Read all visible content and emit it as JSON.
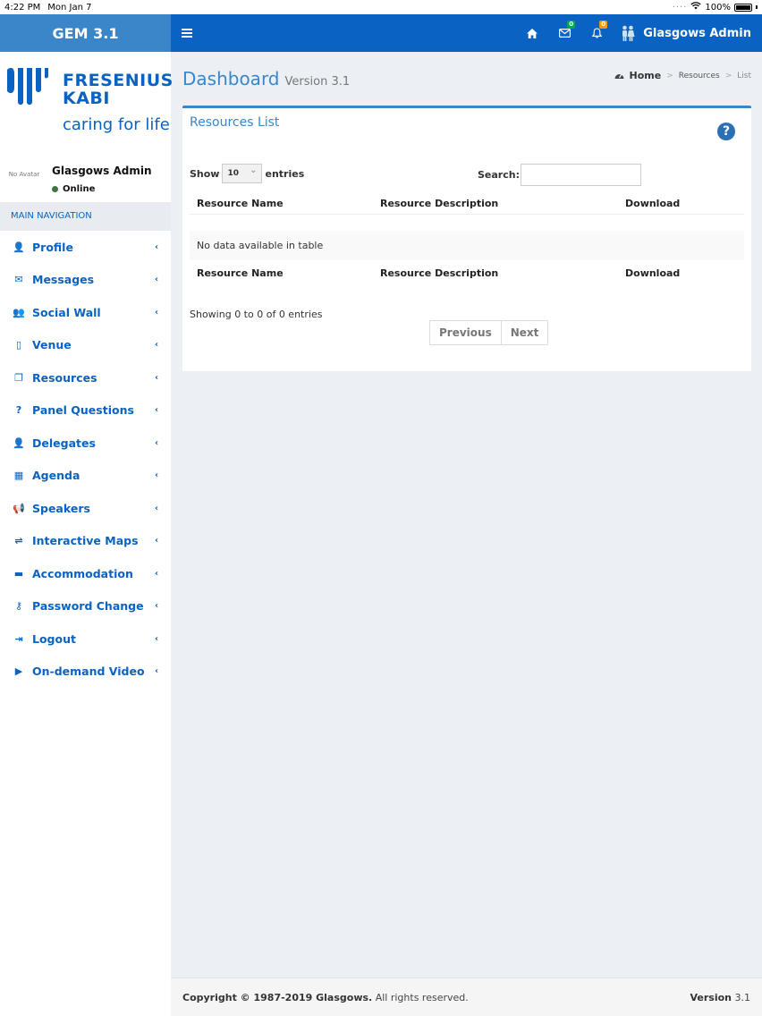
{
  "status_bar": {
    "time": "4:22 PM",
    "date": "Mon Jan 7",
    "battery": "100%"
  },
  "header": {
    "app_name": "GEM 3.1",
    "messages_count": "0",
    "notifications_count": "0",
    "user": "Glasgows Admin"
  },
  "brand": {
    "line1": "FRESENIUS",
    "line2": "KABI",
    "tagline": "caring for life"
  },
  "user_panel": {
    "avatar_text": "No Avatar",
    "name": "Glasgows Admin",
    "status": "Online"
  },
  "sidebar": {
    "header": "MAIN NAVIGATION",
    "items": [
      {
        "label": "Profile",
        "icon": "user-icon"
      },
      {
        "label": "Messages",
        "icon": "envelope-icon"
      },
      {
        "label": "Social Wall",
        "icon": "users-icon"
      },
      {
        "label": "Venue",
        "icon": "building-icon"
      },
      {
        "label": "Resources",
        "icon": "copy-icon"
      },
      {
        "label": "Panel Questions",
        "icon": "question-icon"
      },
      {
        "label": "Delegates",
        "icon": "user-icon"
      },
      {
        "label": "Agenda",
        "icon": "calendar-icon"
      },
      {
        "label": "Speakers",
        "icon": "bullhorn-icon"
      },
      {
        "label": "Interactive Maps",
        "icon": "signpost-icon"
      },
      {
        "label": "Accommodation",
        "icon": "bed-icon"
      },
      {
        "label": "Password Change",
        "icon": "key-icon"
      },
      {
        "label": "Logout",
        "icon": "sign-out-icon"
      },
      {
        "label": "On-demand Video",
        "icon": "youtube-icon"
      }
    ]
  },
  "page": {
    "title": "Dashboard",
    "subtitle": "Version 3.1"
  },
  "breadcrumb": {
    "home": "Home",
    "section": "Resources",
    "current": "List"
  },
  "box": {
    "title": "Resources List",
    "show_label": "Show",
    "entries_value": "10",
    "entries_label": "entries",
    "search_label": "Search:",
    "search_value": "",
    "columns": [
      "Resource Name",
      "Resource Description",
      "Download"
    ],
    "empty_text": "No data available in table",
    "info": "Showing 0 to 0 of 0 entries",
    "prev_label": "Previous",
    "next_label": "Next"
  },
  "footer": {
    "copyright": "Copyright © 1987-2019 Glasgows.",
    "rights": "All rights reserved.",
    "version_label": "Version",
    "version": "3.1"
  },
  "colors": {
    "primary": "#0a63c2",
    "logo_bar": "#3a86c8",
    "online": "#3c763d",
    "badge_green": "#00a65a",
    "badge_orange": "#f39c12"
  }
}
